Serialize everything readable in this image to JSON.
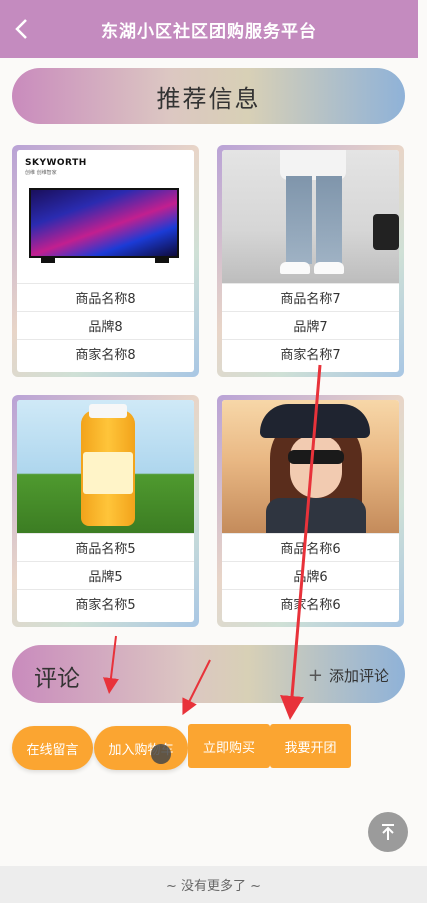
{
  "header": {
    "title": "东湖小区社区团购服务平台",
    "back_icon": "chevron-left-icon"
  },
  "recommend": {
    "title": "推荐信息"
  },
  "products": [
    {
      "name": "商品名称8",
      "brand": "品牌8",
      "merchant": "商家名称8",
      "image": "tv",
      "logo": "SKYWORTH",
      "logo_sub": "创维 创维智家"
    },
    {
      "name": "商品名称7",
      "brand": "品牌7",
      "merchant": "商家名称7",
      "image": "jeans"
    },
    {
      "name": "商品名称5",
      "brand": "品牌5",
      "merchant": "商家名称5",
      "image": "juice"
    },
    {
      "name": "商品名称6",
      "brand": "品牌6",
      "merchant": "商家名称6",
      "image": "girl"
    }
  ],
  "comments": {
    "title": "评论",
    "add_label": "添加评论",
    "add_icon": "plus-icon"
  },
  "actions": {
    "message": "在线留言",
    "add_cart": "加入购物车",
    "buy_now": "立即购买",
    "group_buy": "我要开团"
  },
  "scroll_top_icon": "arrow-up-icon",
  "footer": {
    "text": "~ 没有更多了 ~"
  },
  "colors": {
    "header": "#c48bbf",
    "button": "#fba531",
    "arrow": "#e8323a"
  }
}
